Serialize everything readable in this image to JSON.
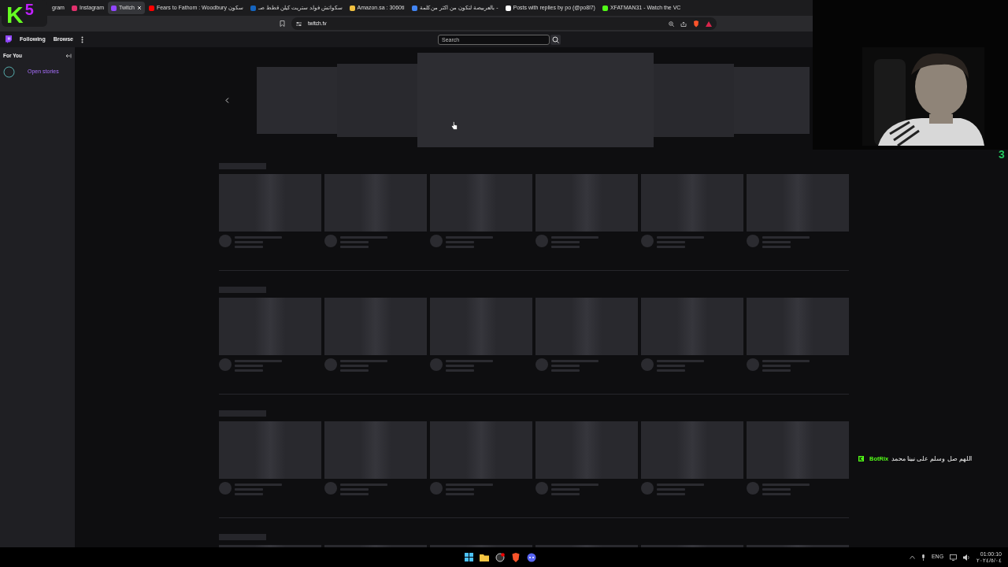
{
  "overlay_logo": {
    "letter": "K",
    "digit": "5"
  },
  "tabs": [
    {
      "label": "gram",
      "selected": false
    },
    {
      "label": "Instagram",
      "selected": false
    },
    {
      "label": "Twitch",
      "selected": true
    },
    {
      "label": "Fears to Fathom : Woodbury سكون",
      "selected": false
    },
    {
      "label": "سكواتش فولد ستريت كيلن قطط صـ",
      "selected": false
    },
    {
      "label": "Amazon.sa : 3060ti",
      "selected": false
    },
    {
      "label": "بالعربيصة لتكون من اكثر من كلمة -",
      "selected": false
    },
    {
      "label": "Posts with replies by po (@po8l7)",
      "selected": false
    },
    {
      "label": "XFATMAN31 - Watch the VC",
      "selected": false
    }
  ],
  "address_bar": {
    "url": "twitch.tv"
  },
  "twitch_nav": {
    "items": [
      "Following",
      "Browse"
    ],
    "search": {
      "placeholder": "Search"
    }
  },
  "sidebar": {
    "title": "For You",
    "stories_label": "Open stories"
  },
  "shelves": [
    {
      "kind": "loading"
    },
    {
      "kind": "loading"
    },
    {
      "kind": "loading"
    },
    {
      "kind": "loading"
    }
  ],
  "chat_message": {
    "user": "BotRix",
    "text": "اللهم صل وسلم على نبينا محمد"
  },
  "side_mark": "3",
  "taskbar": {
    "language": "ENG",
    "time": "01:00:10",
    "date": "٢٠٢٤/٥/٠٤"
  }
}
